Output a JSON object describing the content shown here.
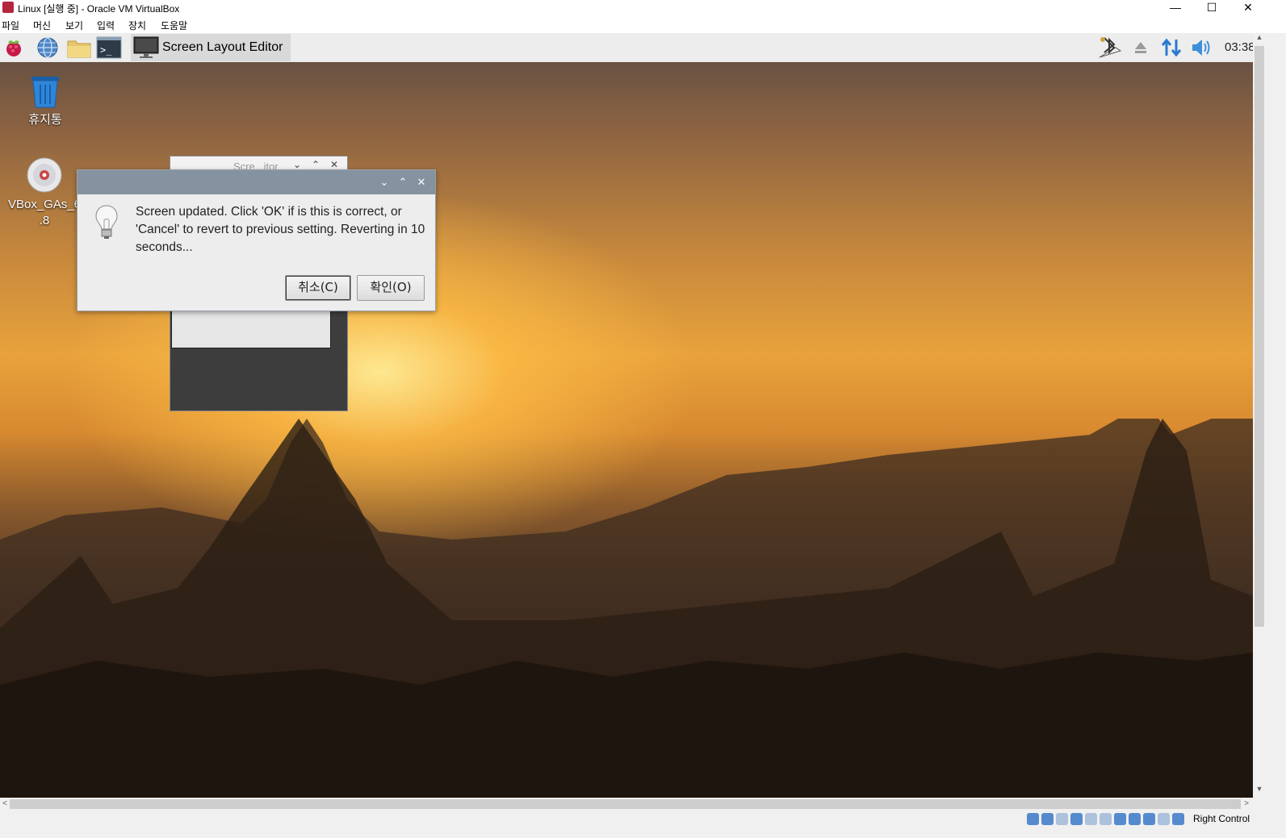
{
  "host_window": {
    "title": "Linux [실행 중] - Oracle VM VirtualBox",
    "minimize_glyph": "—",
    "maximize_glyph": "☐",
    "close_glyph": "✕"
  },
  "host_menu": {
    "items": [
      {
        "label": "파일"
      },
      {
        "label": "머신"
      },
      {
        "label": "보기"
      },
      {
        "label": "입력"
      },
      {
        "label": "장치"
      },
      {
        "label": "도움말"
      }
    ]
  },
  "panel": {
    "launchers": [
      "raspberry-menu-icon",
      "web-browser-icon",
      "file-manager-icon",
      "terminal-icon"
    ],
    "task": {
      "label": "Screen Layout Editor",
      "icon": "monitor-icon"
    },
    "tray": [
      "bluetooth-icon",
      "eject-icon",
      "network-arrows-icon",
      "volume-icon"
    ],
    "clock": "03:38"
  },
  "desktop": {
    "icons": [
      {
        "label": "휴지통",
        "icon": "trash-icon"
      },
      {
        "label_line1": "VBox_GAs_6",
        "label_line2": ".8",
        "icon": "cd-icon"
      }
    ]
  },
  "background_window": {
    "title": "Scre...itor"
  },
  "dialog": {
    "message": "Screen updated. Click 'OK' if is this is correct, or 'Cancel' to revert to previous setting. Reverting in 10 seconds...",
    "cancel_label": "취소(C)",
    "ok_label": "확인(O)",
    "colors": {
      "titlebar": "#8592a0"
    }
  },
  "status_bar": {
    "host_key": "Right Control"
  },
  "scrollbars": {
    "up": "▲",
    "down": "▼",
    "left": "<",
    "right": ">"
  }
}
